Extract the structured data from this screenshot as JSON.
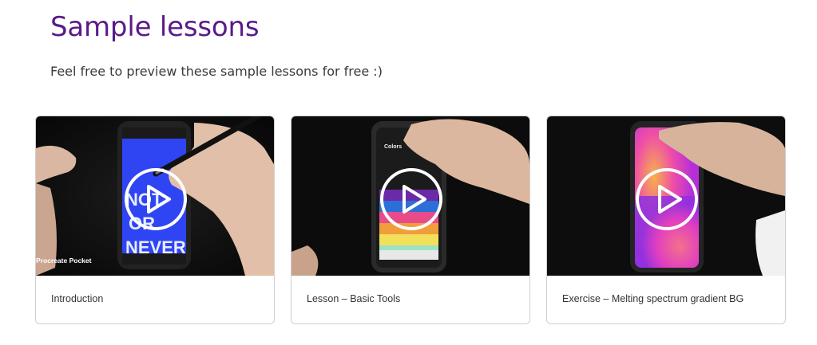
{
  "header": {
    "title": "Sample lessons",
    "subtitle": "Feel free to preview these sample lessons for free :)"
  },
  "colors": {
    "title": "#5a1a8a",
    "subtitle": "#3a3a3a",
    "card_border": "#cfcfcf",
    "thumbnail_bg": "#0f0f0f"
  },
  "lessons": [
    {
      "caption": "Introduction",
      "thumbnail": {
        "screen": "now-or-never-blue",
        "overlay_text": "Procreate Pocket"
      },
      "icon": "play-circle-icon"
    },
    {
      "caption": "Lesson – Basic Tools",
      "thumbnail": {
        "screen": "colors-palette",
        "app_heading": "Colors"
      },
      "icon": "play-circle-icon"
    },
    {
      "caption": "Exercise – Melting spectrum gradient BG",
      "thumbnail": {
        "screen": "pink-blob-gradient"
      },
      "icon": "play-circle-icon"
    }
  ]
}
